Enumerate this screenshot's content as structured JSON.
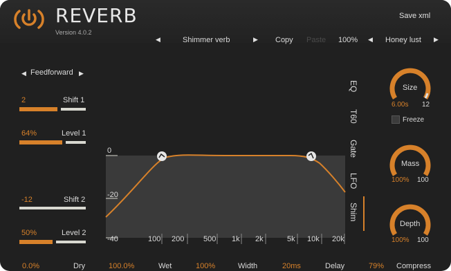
{
  "header": {
    "title": "REVERB",
    "version": "Version 4.0.2",
    "save_label": "Save xml",
    "logo_icon": "power-icon"
  },
  "preset_bar": {
    "prev_preset_icon": "triangle-left-icon",
    "preset_name": "Shimmer verb",
    "next_preset_icon": "triangle-right-icon",
    "copy_label": "Copy",
    "paste_label": "Paste",
    "zoom": "100%",
    "bank_prev_icon": "triangle-left-icon",
    "bank_name": "Honey lust",
    "bank_next_icon": "triangle-right-icon"
  },
  "left_panel": {
    "mode_label": "Feedforward",
    "shift1": {
      "label": "Shift 1",
      "value": "2",
      "fill": 0.55
    },
    "level1": {
      "label": "Level 1",
      "value": "64%",
      "fill": 0.64
    },
    "shift2": {
      "label": "Shift 2",
      "value": "-12",
      "fill": 0.0
    },
    "level2": {
      "label": "Level 2",
      "value": "50%",
      "fill": 0.5
    }
  },
  "graph": {
    "y_ticks": [
      "0",
      "-20",
      "-40"
    ],
    "x_ticks": [
      "100",
      "200",
      "500",
      "1k",
      "2k",
      "5k",
      "10k",
      "20k"
    ]
  },
  "tabs": [
    "EQ",
    "T60",
    "Gate",
    "LFO",
    "Shim"
  ],
  "active_tab": "Shim",
  "knobs": {
    "size": {
      "label": "Size",
      "value": "6.00s",
      "max": "12",
      "level": 0.5
    },
    "freeze_label": "Freeze",
    "mass": {
      "label": "Mass",
      "value": "100%",
      "max": "100",
      "level": 1.0
    },
    "depth": {
      "label": "Depth",
      "value": "100%",
      "max": "100",
      "level": 1.0
    }
  },
  "bottom": {
    "dry_value": "0.0%",
    "dry_label": "Dry",
    "wet_value": "100.0%",
    "wet_label": "Wet",
    "width_value": "100%",
    "width_label": "Width",
    "delay_value": "20ms",
    "delay_label": "Delay",
    "compress_value": "79%",
    "compress_label": "Compress"
  },
  "colors": {
    "accent": "#d7812a",
    "background": "#202020",
    "text": "#d9d9d9"
  }
}
